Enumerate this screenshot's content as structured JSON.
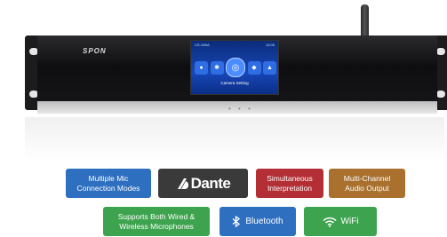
{
  "product": {
    "brand": "SPON",
    "screen": {
      "status_left": "CS-V80A",
      "status_right": "12:00",
      "caption": "Camera Setting",
      "icons": [
        "mic-icon",
        "settings-icon",
        "camera-icon",
        "network-icon",
        "audio-icon"
      ]
    }
  },
  "badges": {
    "mic": "Multiple Mic Connection Modes",
    "mic_line1": "Multiple Mic",
    "mic_line2": "Connection Modes",
    "dante": "Dante",
    "simultaneous_line1": "Simultaneous",
    "simultaneous_line2": "Interpretation",
    "multi_line1": "Multi-Channel",
    "multi_line2": "Audio Output",
    "wired_line1": "Supports Both Wired &",
    "wired_line2": "Wireless Microphones",
    "bluetooth": "Bluetooth",
    "wifi": "WiFi"
  },
  "colors": {
    "blue": "#2e6fbf",
    "dark": "#3a3a3a",
    "red": "#b32f35",
    "bronze": "#a9702e",
    "green": "#3ea34f"
  }
}
